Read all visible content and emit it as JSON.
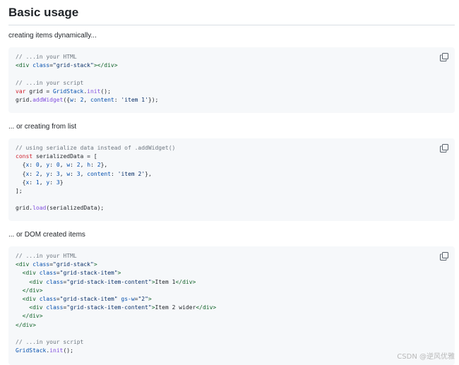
{
  "heading": "Basic usage",
  "intro": "creating items dynamically...",
  "list_text": "... or creating from list",
  "dom_text": "... or DOM created items",
  "watermark": "CSDN @逆风优雅",
  "icons": {
    "copy": "copy-icon"
  },
  "code1": [
    [
      {
        "c": "c",
        "t": "// ...in your HTML"
      }
    ],
    [
      {
        "c": "t",
        "t": "<div"
      },
      {
        "c": "",
        "t": " "
      },
      {
        "c": "p",
        "t": "class"
      },
      {
        "c": "",
        "t": "="
      },
      {
        "c": "s",
        "t": "\"grid-stack\""
      },
      {
        "c": "t",
        "t": "></div>"
      }
    ],
    [
      {
        "c": "",
        "t": ""
      }
    ],
    [
      {
        "c": "c",
        "t": "// ...in your script"
      }
    ],
    [
      {
        "c": "k",
        "t": "var"
      },
      {
        "c": "",
        "t": " grid = "
      },
      {
        "c": "p",
        "t": "GridStack"
      },
      {
        "c": "",
        "t": "."
      },
      {
        "c": "f",
        "t": "init"
      },
      {
        "c": "",
        "t": "();"
      }
    ],
    [
      {
        "c": "",
        "t": "grid."
      },
      {
        "c": "f",
        "t": "addWidget"
      },
      {
        "c": "",
        "t": "({"
      },
      {
        "c": "p",
        "t": "w"
      },
      {
        "c": "",
        "t": ": "
      },
      {
        "c": "p",
        "t": "2"
      },
      {
        "c": "",
        "t": ", "
      },
      {
        "c": "p",
        "t": "content"
      },
      {
        "c": "",
        "t": ": "
      },
      {
        "c": "s",
        "t": "'item 1'"
      },
      {
        "c": "",
        "t": "});"
      }
    ]
  ],
  "code2": [
    [
      {
        "c": "c",
        "t": "// using serialize data instead of .addWidget()"
      }
    ],
    [
      {
        "c": "k",
        "t": "const"
      },
      {
        "c": "",
        "t": " serializedData = ["
      }
    ],
    [
      {
        "c": "",
        "t": "  {"
      },
      {
        "c": "p",
        "t": "x"
      },
      {
        "c": "",
        "t": ": "
      },
      {
        "c": "p",
        "t": "0"
      },
      {
        "c": "",
        "t": ", "
      },
      {
        "c": "p",
        "t": "y"
      },
      {
        "c": "",
        "t": ": "
      },
      {
        "c": "p",
        "t": "0"
      },
      {
        "c": "",
        "t": ", "
      },
      {
        "c": "p",
        "t": "w"
      },
      {
        "c": "",
        "t": ": "
      },
      {
        "c": "p",
        "t": "2"
      },
      {
        "c": "",
        "t": ", "
      },
      {
        "c": "p",
        "t": "h"
      },
      {
        "c": "",
        "t": ": "
      },
      {
        "c": "p",
        "t": "2"
      },
      {
        "c": "",
        "t": "},"
      }
    ],
    [
      {
        "c": "",
        "t": "  {"
      },
      {
        "c": "p",
        "t": "x"
      },
      {
        "c": "",
        "t": ": "
      },
      {
        "c": "p",
        "t": "2"
      },
      {
        "c": "",
        "t": ", "
      },
      {
        "c": "p",
        "t": "y"
      },
      {
        "c": "",
        "t": ": "
      },
      {
        "c": "p",
        "t": "3"
      },
      {
        "c": "",
        "t": ", "
      },
      {
        "c": "p",
        "t": "w"
      },
      {
        "c": "",
        "t": ": "
      },
      {
        "c": "p",
        "t": "3"
      },
      {
        "c": "",
        "t": ", "
      },
      {
        "c": "p",
        "t": "content"
      },
      {
        "c": "",
        "t": ": "
      },
      {
        "c": "s",
        "t": "'item 2'"
      },
      {
        "c": "",
        "t": "},"
      }
    ],
    [
      {
        "c": "",
        "t": "  {"
      },
      {
        "c": "p",
        "t": "x"
      },
      {
        "c": "",
        "t": ": "
      },
      {
        "c": "p",
        "t": "1"
      },
      {
        "c": "",
        "t": ", "
      },
      {
        "c": "p",
        "t": "y"
      },
      {
        "c": "",
        "t": ": "
      },
      {
        "c": "p",
        "t": "3"
      },
      {
        "c": "",
        "t": "}"
      }
    ],
    [
      {
        "c": "",
        "t": "];"
      }
    ],
    [
      {
        "c": "",
        "t": ""
      }
    ],
    [
      {
        "c": "",
        "t": "grid."
      },
      {
        "c": "f",
        "t": "load"
      },
      {
        "c": "",
        "t": "(serializedData);"
      }
    ]
  ],
  "code3": [
    [
      {
        "c": "c",
        "t": "// ...in your HTML"
      }
    ],
    [
      {
        "c": "t",
        "t": "<div"
      },
      {
        "c": "",
        "t": " "
      },
      {
        "c": "p",
        "t": "class"
      },
      {
        "c": "",
        "t": "="
      },
      {
        "c": "s",
        "t": "\"grid-stack\""
      },
      {
        "c": "t",
        "t": ">"
      }
    ],
    [
      {
        "c": "",
        "t": "  "
      },
      {
        "c": "t",
        "t": "<div"
      },
      {
        "c": "",
        "t": " "
      },
      {
        "c": "p",
        "t": "class"
      },
      {
        "c": "",
        "t": "="
      },
      {
        "c": "s",
        "t": "\"grid-stack-item\""
      },
      {
        "c": "t",
        "t": ">"
      }
    ],
    [
      {
        "c": "",
        "t": "    "
      },
      {
        "c": "t",
        "t": "<div"
      },
      {
        "c": "",
        "t": " "
      },
      {
        "c": "p",
        "t": "class"
      },
      {
        "c": "",
        "t": "="
      },
      {
        "c": "s",
        "t": "\"grid-stack-item-content\""
      },
      {
        "c": "t",
        "t": ">"
      },
      {
        "c": "",
        "t": "Item 1"
      },
      {
        "c": "t",
        "t": "</div>"
      }
    ],
    [
      {
        "c": "",
        "t": "  "
      },
      {
        "c": "t",
        "t": "</div>"
      }
    ],
    [
      {
        "c": "",
        "t": "  "
      },
      {
        "c": "t",
        "t": "<div"
      },
      {
        "c": "",
        "t": " "
      },
      {
        "c": "p",
        "t": "class"
      },
      {
        "c": "",
        "t": "="
      },
      {
        "c": "s",
        "t": "\"grid-stack-item\""
      },
      {
        "c": "",
        "t": " "
      },
      {
        "c": "p",
        "t": "gs-w"
      },
      {
        "c": "",
        "t": "="
      },
      {
        "c": "s",
        "t": "\"2\""
      },
      {
        "c": "t",
        "t": ">"
      }
    ],
    [
      {
        "c": "",
        "t": "    "
      },
      {
        "c": "t",
        "t": "<div"
      },
      {
        "c": "",
        "t": " "
      },
      {
        "c": "p",
        "t": "class"
      },
      {
        "c": "",
        "t": "="
      },
      {
        "c": "s",
        "t": "\"grid-stack-item-content\""
      },
      {
        "c": "t",
        "t": ">"
      },
      {
        "c": "",
        "t": "Item 2 wider"
      },
      {
        "c": "t",
        "t": "</div>"
      }
    ],
    [
      {
        "c": "",
        "t": "  "
      },
      {
        "c": "t",
        "t": "</div>"
      }
    ],
    [
      {
        "c": "t",
        "t": "</div>"
      }
    ],
    [
      {
        "c": "",
        "t": ""
      }
    ],
    [
      {
        "c": "c",
        "t": "// ...in your script"
      }
    ],
    [
      {
        "c": "p",
        "t": "GridStack"
      },
      {
        "c": "",
        "t": "."
      },
      {
        "c": "f",
        "t": "init"
      },
      {
        "c": "",
        "t": "();"
      }
    ]
  ]
}
